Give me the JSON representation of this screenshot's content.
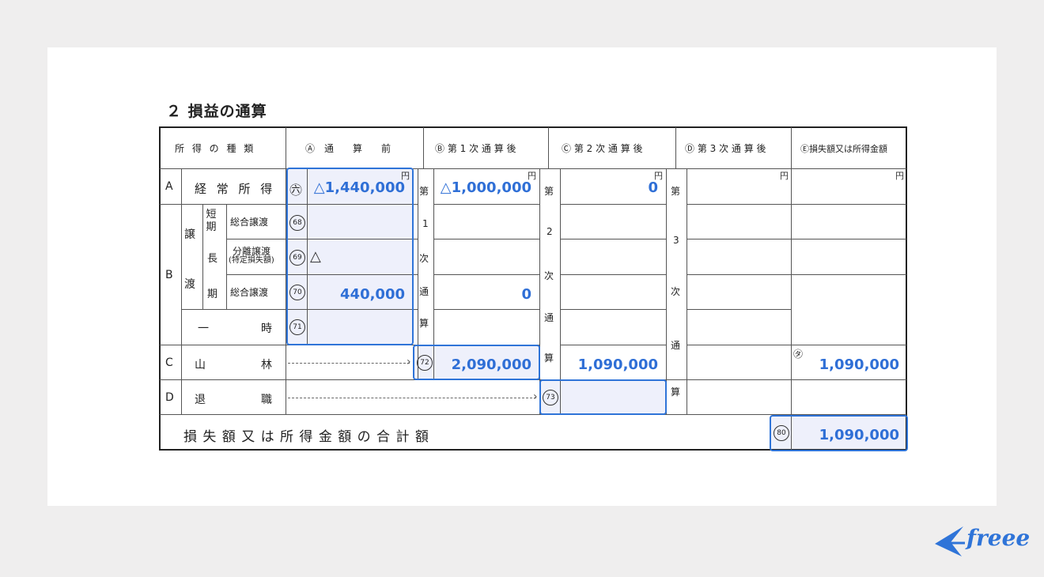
{
  "section_title": "２ 損益の通算",
  "headers": {
    "type": "所 得 の 種 類",
    "a": "Ⓐ　通　　算　　前",
    "b": "Ⓑ 第 1 次 通 算 後",
    "c": "Ⓒ 第 2 次 通 算 後",
    "d": "Ⓓ 第 3 次 通 算 後",
    "e": "Ⓔ損失額又は所得金額"
  },
  "rows": {
    "a_letter": "A",
    "a_label": "経 常 所 得",
    "b_letter": "B",
    "jou": "譲",
    "to": "渡",
    "tanki": "短期",
    "chou": "長",
    "ki": "期",
    "sogo1": "総合譲渡",
    "bunri1": "分離譲渡",
    "bunri2": "(特定損失額)",
    "sogo2": "総合譲渡",
    "ichi1": "一",
    "ichi2": "時",
    "c_letter": "C",
    "c_label1": "山",
    "c_label2": "林",
    "d_letter": "D",
    "d_label1": "退",
    "d_label2": "職",
    "total_label": "損 失 額 又 は 所 得 金 額 の 合 計 額"
  },
  "circled": {
    "n66": "㊅",
    "n68": "68",
    "n69": "69",
    "n70": "70",
    "n71": "71",
    "n72": "72",
    "n73": "73",
    "n80": "80",
    "ta": "㋟"
  },
  "vertical": {
    "v1": [
      "第",
      "1",
      "次",
      "通",
      "算"
    ],
    "v2": [
      "第",
      "2",
      "次",
      "通",
      "算"
    ],
    "v3": [
      "第",
      "3",
      "次",
      "通",
      "算"
    ]
  },
  "yen": "円",
  "values": {
    "a_before": "△1,440,000",
    "a_first": "△1,000,000",
    "a_second": "0",
    "b69": "△",
    "b70": "440,000",
    "b70_first": "0",
    "c_first": "2,090,000",
    "c_second": "1,090,000",
    "c_e": "1,090,000",
    "total": "1,090,000"
  },
  "brand": "freee",
  "colors": {
    "accent": "#2f74d8",
    "highlight": "#eef0fb"
  }
}
